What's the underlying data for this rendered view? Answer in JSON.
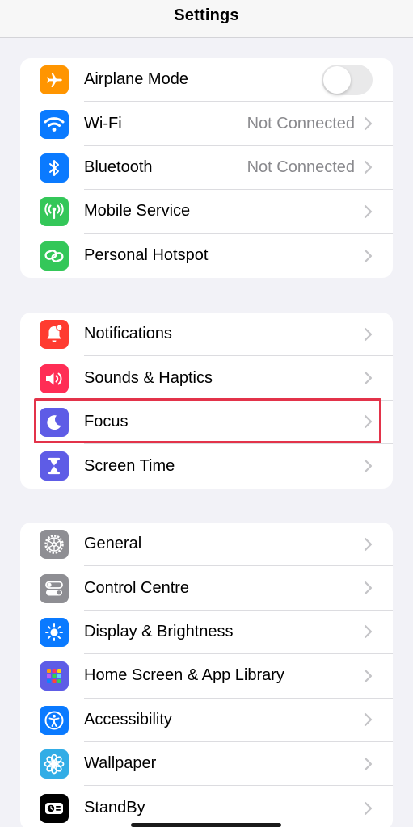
{
  "navbar": {
    "title": "Settings"
  },
  "groups": [
    {
      "items": [
        {
          "label": "Airplane Mode",
          "icon": "airplane-icon",
          "icon_bg": "#ff9500",
          "control": "toggle",
          "toggle_on": false
        },
        {
          "label": "Wi-Fi",
          "icon": "wifi-icon",
          "icon_bg": "#0a7aff",
          "value": "Not Connected"
        },
        {
          "label": "Bluetooth",
          "icon": "bluetooth-icon",
          "icon_bg": "#0a7aff",
          "value": "Not Connected"
        },
        {
          "label": "Mobile Service",
          "icon": "antenna-icon",
          "icon_bg": "#34c759"
        },
        {
          "label": "Personal Hotspot",
          "icon": "link-icon",
          "icon_bg": "#34c759"
        }
      ]
    },
    {
      "items": [
        {
          "label": "Notifications",
          "icon": "bell-icon",
          "icon_bg": "#ff3b30"
        },
        {
          "label": "Sounds & Haptics",
          "icon": "speaker-icon",
          "icon_bg": "#ff2d55"
        },
        {
          "label": "Focus",
          "icon": "moon-icon",
          "icon_bg": "#5e5ce6",
          "highlighted": true
        },
        {
          "label": "Screen Time",
          "icon": "hourglass-icon",
          "icon_bg": "#5e5ce6"
        }
      ]
    },
    {
      "items": [
        {
          "label": "General",
          "icon": "gear-icon",
          "icon_bg": "#8e8e93"
        },
        {
          "label": "Control Centre",
          "icon": "switches-icon",
          "icon_bg": "#8e8e93"
        },
        {
          "label": "Display & Brightness",
          "icon": "sun-icon",
          "icon_bg": "#0a7aff"
        },
        {
          "label": "Home Screen & App Library",
          "icon": "app-grid-icon",
          "icon_bg": "#5e5ce6"
        },
        {
          "label": "Accessibility",
          "icon": "accessibility-icon",
          "icon_bg": "#0a7aff"
        },
        {
          "label": "Wallpaper",
          "icon": "flower-icon",
          "icon_bg": "#32ade6"
        },
        {
          "label": "StandBy",
          "icon": "standby-icon",
          "icon_bg": "#000000"
        }
      ]
    }
  ],
  "colors": {
    "highlight": "#e3334a",
    "background": "#f2f2f7"
  }
}
